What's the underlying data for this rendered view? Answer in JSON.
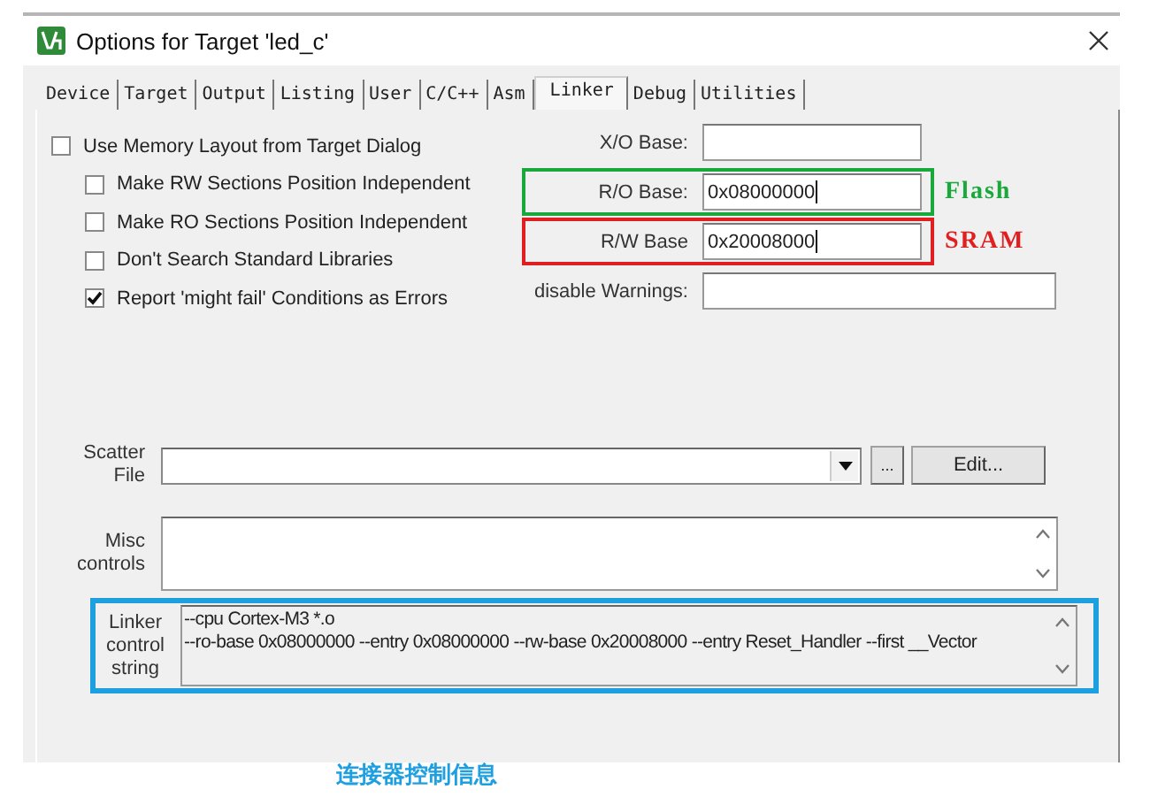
{
  "window": {
    "title": "Options for Target 'led_c'"
  },
  "tabs": [
    {
      "label": "Device",
      "selected": false
    },
    {
      "label": "Target",
      "selected": false
    },
    {
      "label": "Output",
      "selected": false
    },
    {
      "label": "Listing",
      "selected": false
    },
    {
      "label": "User",
      "selected": false
    },
    {
      "label": "C/C++",
      "selected": false
    },
    {
      "label": "Asm",
      "selected": false
    },
    {
      "label": "Linker",
      "selected": true
    },
    {
      "label": "Debug",
      "selected": false
    },
    {
      "label": "Utilities",
      "selected": false
    }
  ],
  "options": [
    {
      "label": "Use Memory Layout from Target Dialog",
      "checked": false,
      "children": [
        {
          "label": "Make RW Sections Position Independent",
          "checked": false
        },
        {
          "label": "Make RO Sections Position Independent",
          "checked": false
        },
        {
          "label": "Don't Search Standard Libraries",
          "checked": false
        },
        {
          "label": "Report 'might fail' Conditions as Errors",
          "checked": true
        }
      ]
    }
  ],
  "fields": [
    {
      "label": "X/O Base:",
      "kind": "short"
    },
    {
      "label": "R/O Base:",
      "value": "0x08000000",
      "kind": "short",
      "annotation": {
        "note": "Flash",
        "color": "#1aa83c"
      }
    },
    {
      "label": "R/W Base",
      "value": "0x20008000",
      "kind": "short",
      "annotation": {
        "note": "SRAM",
        "color": "#e02020"
      }
    },
    {
      "label": "disable Warnings:",
      "kind": "long"
    }
  ],
  "scatter_file": {
    "label": "Scatter File",
    "browse": "...",
    "edit": "Edit..."
  },
  "misc": {
    "label": "Misc controls"
  },
  "linker": {
    "label": "Linker control string",
    "lines": [
      "--cpu Cortex-M3 *.o",
      "--ro-base 0x08000000 --entry 0x08000000 --rw-base 0x20008000 --entry Reset_Handler --first __Vector"
    ],
    "annotation": {
      "color": "#1ea0e0",
      "caption": "连接器控制信息"
    }
  }
}
